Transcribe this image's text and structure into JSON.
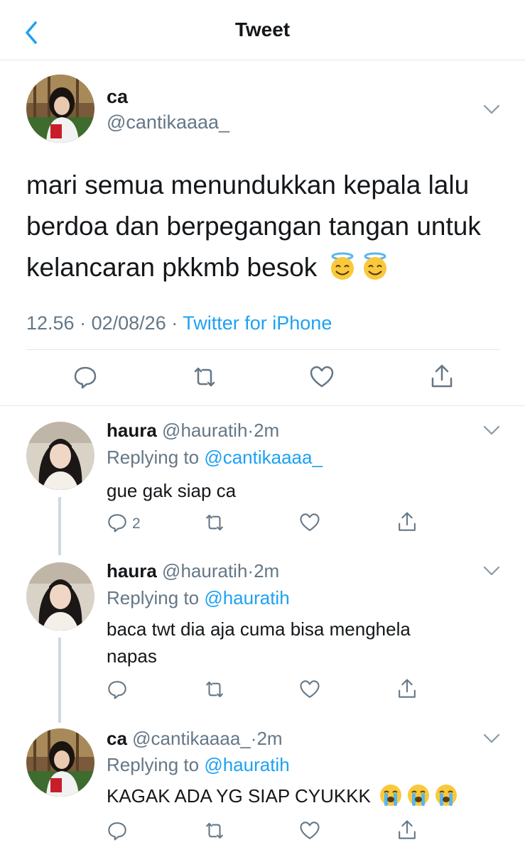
{
  "header": {
    "title": "Tweet"
  },
  "main_tweet": {
    "name": "ca",
    "handle": "@cantikaaaa_",
    "text": "mari semua menundukkan kepala lalu berdoa dan berpegangan tangan untuk kelancaran pkkmb besok",
    "emoji": "😇😇",
    "time": "12.56",
    "sep1": "·",
    "date": "02/08/26",
    "sep2": "·",
    "source": "Twitter for iPhone"
  },
  "replies": [
    {
      "name": "haura",
      "handle": "@hauratih",
      "dot": "·",
      "time": "2m",
      "replying_prefix": "Replying to",
      "replying_to": "@cantikaaaa_",
      "text": "gue gak siap ca",
      "reply_count": "2"
    },
    {
      "name": "haura",
      "handle": "@hauratih",
      "dot": "·",
      "time": "2m",
      "replying_prefix": "Replying to",
      "replying_to": "@hauratih",
      "text": "baca twt dia aja cuma bisa menghela napas",
      "reply_count": ""
    },
    {
      "name": "ca",
      "handle": "@cantikaaaa_",
      "dot": "·",
      "time": "2m",
      "replying_prefix": "Replying to",
      "replying_to": "@hauratih",
      "text": "KAGAK ADA YG SIAP CYUKKK",
      "emoji": "😭😭😭",
      "reply_count": ""
    }
  ],
  "colors": {
    "accent": "#1da1f2",
    "muted": "#657786",
    "divider": "#e6e6e6",
    "thread": "#cfd9de"
  }
}
